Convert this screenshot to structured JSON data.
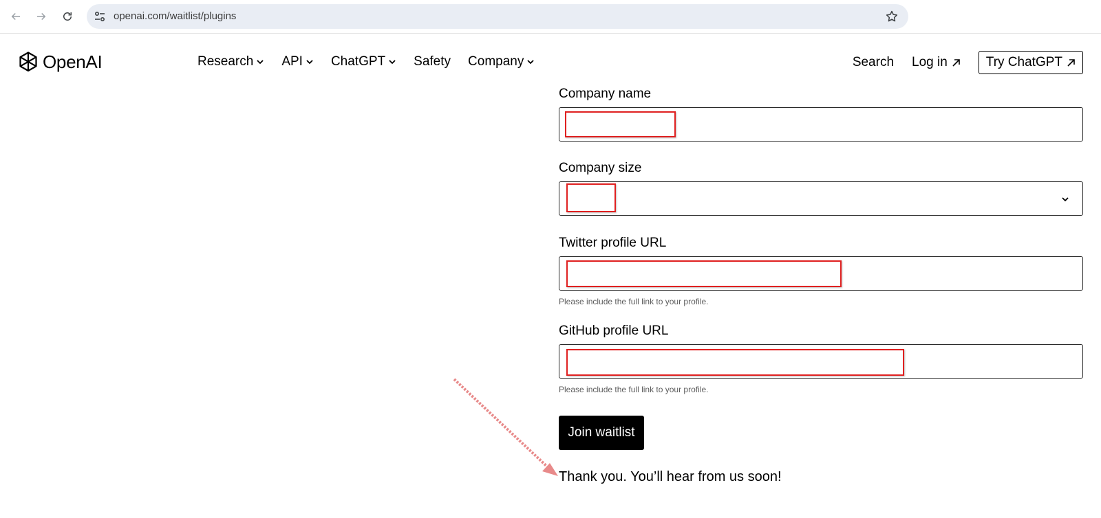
{
  "browser": {
    "url": "openai.com/waitlist/plugins"
  },
  "header": {
    "logo_text": "OpenAI",
    "nav": [
      {
        "label": "Research",
        "has_dropdown": true
      },
      {
        "label": "API",
        "has_dropdown": true
      },
      {
        "label": "ChatGPT",
        "has_dropdown": true
      },
      {
        "label": "Safety",
        "has_dropdown": false
      },
      {
        "label": "Company",
        "has_dropdown": true
      }
    ],
    "search_label": "Search",
    "login_label": "Log in",
    "try_label": "Try ChatGPT"
  },
  "form": {
    "company_name_label": "Company name",
    "company_size_label": "Company size",
    "twitter_label": "Twitter profile URL",
    "twitter_helper": "Please include the full link to your profile.",
    "github_label": "GitHub profile URL",
    "github_helper": "Please include the full link to your profile.",
    "submit_label": "Join waitlist",
    "confirmation": "Thank you. You’ll hear from us soon!"
  },
  "colors": {
    "redaction": "#e02020",
    "annotation_arrow": "#e88a8a",
    "button_bg": "#000000"
  }
}
